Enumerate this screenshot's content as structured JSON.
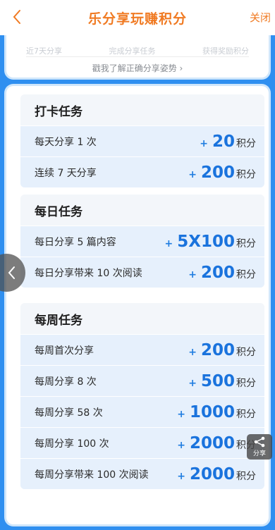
{
  "header": {
    "title": "乐分享玩赚积分",
    "close_label": "关闭"
  },
  "top_card": {
    "faded_items": [
      "近7天分享",
      "完成分享任务",
      "获得奖励积分"
    ],
    "guide_link": "戳我了解正确分享姿势 ›"
  },
  "sections": [
    {
      "title": "打卡任务",
      "rows": [
        {
          "label": "每天分享 1 次",
          "plus": "+",
          "amount": "20",
          "unit": "积分"
        },
        {
          "label": "连续 7 天分享",
          "plus": "+",
          "amount": "200",
          "unit": "积分"
        }
      ]
    },
    {
      "title": "每日任务",
      "rows": [
        {
          "label": "每日分享 5 篇内容",
          "plus": "+",
          "amount": "5X100",
          "unit": "积分"
        },
        {
          "label": "每日分享带来 10 次阅读",
          "plus": "+",
          "amount": "200",
          "unit": "积分"
        }
      ]
    },
    {
      "title": "每周任务",
      "rows": [
        {
          "label": "每周首次分享",
          "plus": "+",
          "amount": "200",
          "unit": "积分"
        },
        {
          "label": "每周分享 8 次",
          "plus": "+",
          "amount": "500",
          "unit": "积分"
        },
        {
          "label": "每周分享 58 次",
          "plus": "+",
          "amount": "1000",
          "unit": "积分"
        },
        {
          "label": "每周分享 100 次",
          "plus": "+",
          "amount": "2000",
          "unit": "积分"
        },
        {
          "label": "每周分享带来 100 次阅读",
          "plus": "+",
          "amount": "2000",
          "unit": "积分"
        }
      ]
    }
  ],
  "share_float": {
    "label": "分享",
    "icon": "share-icon"
  },
  "colors": {
    "accent_orange": "#f07a22",
    "accent_blue": "#1a73dd",
    "background_blue": "#2f8ff0"
  }
}
